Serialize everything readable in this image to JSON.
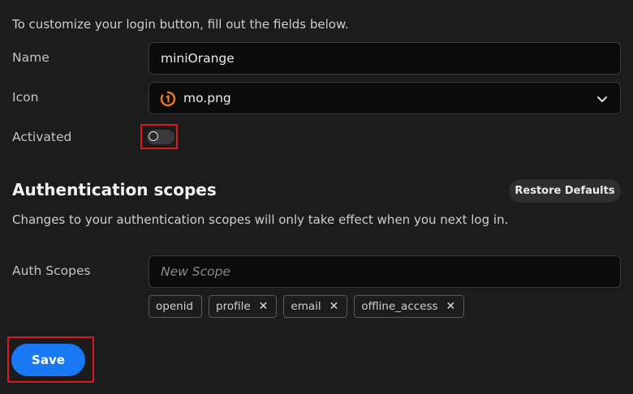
{
  "intro": "To customize your login button, fill out the fields below.",
  "name_field": {
    "label": "Name",
    "value": "miniOrange"
  },
  "icon_field": {
    "label": "Icon",
    "value": "mo.png",
    "logo_icon": "miniorange-logo-icon",
    "chevron_icon": "chevron-down-icon"
  },
  "activated": {
    "label": "Activated",
    "on": false
  },
  "auth_section": {
    "title": "Authentication scopes",
    "restore_label": "Restore Defaults",
    "note": "Changes to your authentication scopes will only take effect when you next log in."
  },
  "auth_scopes": {
    "label": "Auth Scopes",
    "placeholder": "New Scope",
    "chips": [
      {
        "label": "openid",
        "removable": false
      },
      {
        "label": "profile",
        "removable": true
      },
      {
        "label": "email",
        "removable": true
      },
      {
        "label": "offline_access",
        "removable": true
      }
    ],
    "remove_glyph": "✕"
  },
  "save_label": "Save",
  "colors": {
    "accent": "#1877f2",
    "highlight": "#d9181f",
    "background": "#1c1c1d",
    "logo": "#f47c20"
  }
}
